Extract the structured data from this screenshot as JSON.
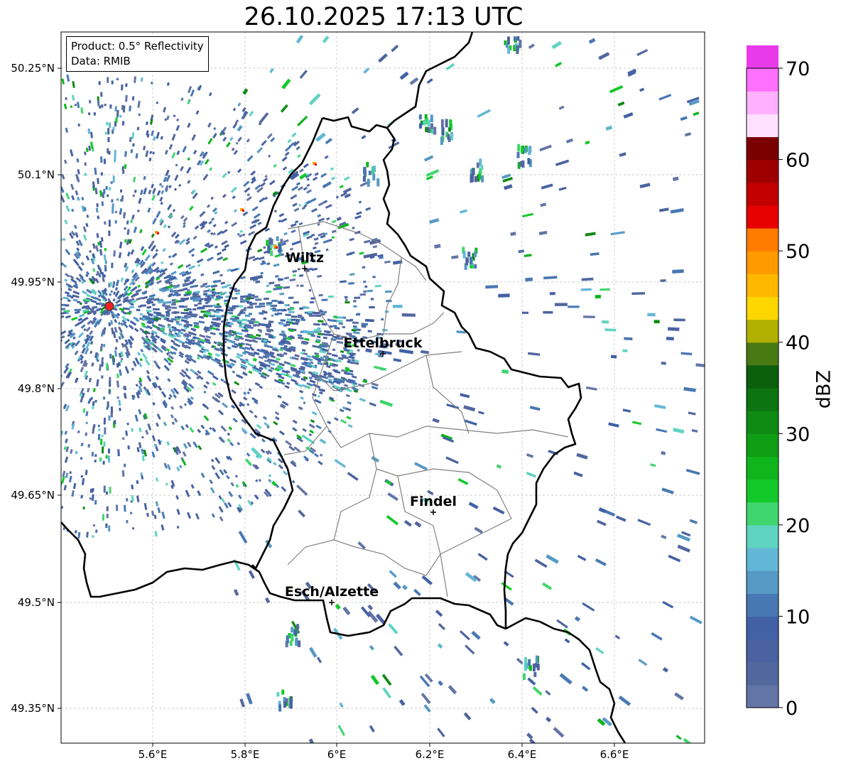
{
  "title": "26.10.2025 17:13 UTC",
  "info": {
    "product": "Product: 0.5° Reflectivity",
    "data": "Data: RMIB"
  },
  "axes": {
    "x_ticks": [
      "5.6°E",
      "5.8°E",
      "6°E",
      "6.2°E",
      "6.4°E",
      "6.6°E"
    ],
    "y_ticks": [
      "50.25°N",
      "50.1°N",
      "49.95°N",
      "49.8°N",
      "49.65°N",
      "49.5°N",
      "49.35°N"
    ]
  },
  "cities": [
    {
      "name": "Wiltz"
    },
    {
      "name": "Ettelbruck"
    },
    {
      "name": "Findel"
    },
    {
      "name": "Esch/Alzette"
    }
  ],
  "colorbar": {
    "label": "dBZ",
    "ticks": [
      "0",
      "10",
      "20",
      "30",
      "40",
      "50",
      "60",
      "70"
    ],
    "colors": [
      "#6374a6",
      "#52679e",
      "#4a62a0",
      "#4261a5",
      "#4878b3",
      "#5699c4",
      "#62b7d6",
      "#5fd3c2",
      "#40d56e",
      "#13c92a",
      "#10b41d",
      "#109e15",
      "#0f8a13",
      "#0c7410",
      "#0a5e0c",
      "#477a12",
      "#b0b000",
      "#ffd700",
      "#ffb700",
      "#ff9a00",
      "#ff7c00",
      "#e60000",
      "#c20000",
      "#9e0000",
      "#7a0000",
      "#ffe0ff",
      "#ffb0ff",
      "#ff70ff",
      "#e83ae8"
    ]
  },
  "colors": {
    "border": "#000000",
    "canton": "#808080",
    "grid": "#bbbbbb",
    "radar_site": "#ee2222"
  }
}
